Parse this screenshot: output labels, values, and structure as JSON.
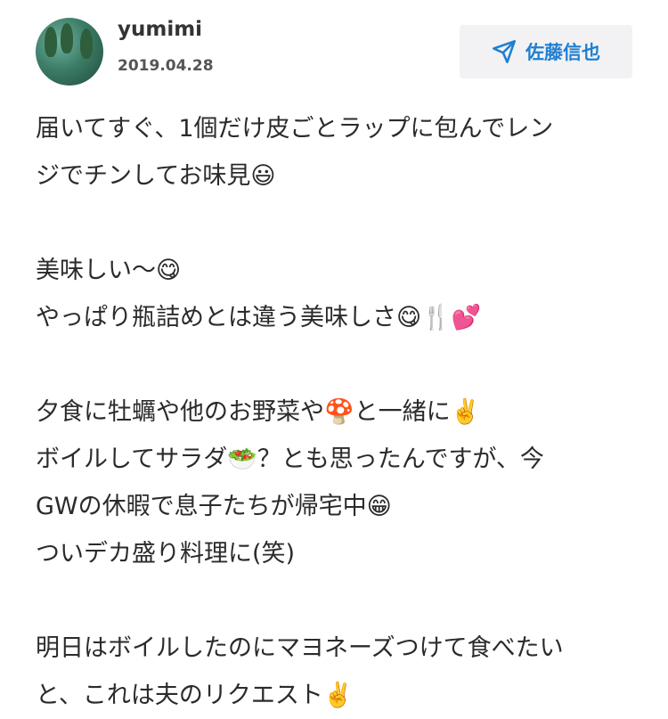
{
  "post": {
    "username": "yumimi",
    "date": "2019.04.28",
    "recipient": "佐藤信也"
  },
  "icons": {
    "avatar": "avatar-photo",
    "recipient": "paper-plane-icon"
  },
  "colors": {
    "accent": "#1f7fd1",
    "button_bg": "#f2f2f4",
    "text": "#2b2b2b"
  },
  "body_lines": [
    "届いてすぐ、1個だけ皮ごとラップに包んでレン",
    "ジでチンしてお味見😃",
    "",
    "美味しい〜😋",
    "やっぱり瓶詰めとは違う美味しさ😋🍴💕",
    "",
    "夕食に牡蠣や他のお野菜や🍄と一緒に✌️",
    "ボイルしてサラダ🥗？とも思ったんですが、今",
    "GWの休暇で息子たちが帰宅中😁",
    "ついデカ盛り料理に(笑)",
    "",
    "明日はボイルしたのにマヨネーズつけて食べたい",
    "と、これは夫のリクエスト✌️"
  ]
}
